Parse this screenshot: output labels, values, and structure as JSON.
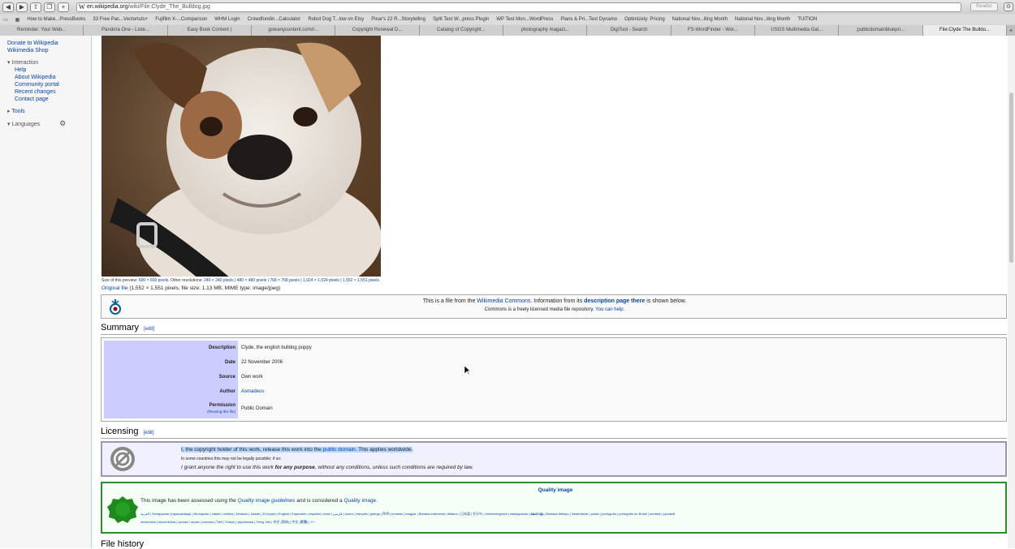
{
  "browser": {
    "url_host": "en.wikipedia.org",
    "url_path": "/wiki/File:Clyde_The_Bulldog.jpg",
    "reader_label": "Reader",
    "bookmarks": [
      "How to Make...PressBooks",
      "33 Free Pac...Vectortuts+",
      "Fujifilm X-...Comparison",
      "WHM Login",
      "Crowdfundin...Calculator",
      "Robot Dog T...low on Etsy",
      "Pixar's 22 R...Storytelling",
      "Split Test W...press Plugin",
      "WP Test Mon...WordPress",
      "Plans & Pri...Test Dynamo",
      "Optimizely: Pricing",
      "National Nov...iting Month",
      "National Nov...iting Month",
      "TUITION"
    ],
    "tabs": [
      "Reminder: Your Web...",
      "Pandora One - Liste...",
      "Easy Book Content |",
      "gowanycontent.com/r...",
      "Copyright Renewal D...",
      "Catalog of Copyright...",
      "photography magazi...",
      "DigiTool - Search",
      "FS-WordFinder - Wor...",
      "USGS Multimedia Gal...",
      "publicdomainbluepri...",
      "File:Clyde The Bulldo..."
    ]
  },
  "sidebar": {
    "top_links": [
      "Donate to Wikipedia",
      "Wikimedia Shop"
    ],
    "interaction_title": "Interaction",
    "interaction_links": [
      "Help",
      "About Wikipedia",
      "Community portal",
      "Recent changes",
      "Contact page"
    ],
    "tools_title": "Tools",
    "languages_title": "Languages"
  },
  "file": {
    "preview_prefix": "Size of this preview:",
    "preview_size": "600 × 600 pixels",
    "other_res_label": ". Other resolutions:",
    "other_res": "240 × 240 pixels | 480 × 480 pixels | 768 × 768 pixels | 1,024 × 1,024 pixels | 1,552 × 1,551 pixels.",
    "original_link": "Original file",
    "original_info": "(1,552 × 1,551 pixels, file size: 1.13 MB, MIME type: image/jpeg)"
  },
  "commons": {
    "line1_a": "This is a file from the",
    "line1_link": "Wikimedia Commons",
    "line1_b": ". Information from its",
    "line1_link2": "description page there",
    "line1_c": "is shown below.",
    "line2_a": "Commons is a freely licensed media file repository.",
    "line2_link": "You can help."
  },
  "summary": {
    "heading": "Summary",
    "edit": "[edit]",
    "rows": [
      {
        "label": "Description",
        "value": "Clyde, the english bulldog puppy"
      },
      {
        "label": "Date",
        "value": "22 November 2006"
      },
      {
        "label": "Source",
        "value": "Own work"
      },
      {
        "label": "Author",
        "value": "Asmadeus"
      },
      {
        "label": "Permission",
        "sub": "(Reusing this file)",
        "value": "Public Domain"
      }
    ]
  },
  "licensing": {
    "heading": "Licensing",
    "edit": "[edit]",
    "line1_a": "I, the copyright holder of this work, release this work into the",
    "line1_link": "public domain",
    "line1_b": ". This applies worldwide.",
    "line2": "In some countries this may not be legally possible; if so:",
    "line3_a": "I grant anyone the right to use this work",
    "line3_bold": "for any purpose",
    "line3_b": ", without any conditions, unless such conditions are required by law."
  },
  "quality": {
    "title": "Quality image",
    "text_a": "This image has been assessed using the",
    "text_link": "Quality image guidelines",
    "text_b": "and is considered a",
    "text_link2": "Quality image",
    "text_c": ".",
    "lang_line1": "العربية | беларуская (тарашкевіца) | български | català | čeština | Deutsch | Zazaki | Ελληνικά | English | Esperanto | español | eesti | فارسی | suomi | français | galego | हिन्दी | hrvatski | magyar | Bahasa Indonesia | italiano | 日本語 | 한국어 | Lëtzebuergesch | македонски | മലയാളം | Bahasa Melayu | Nederlands | polski | português | português do Brasil | română | русский",
    "lang_line2": "slovenčina | slovenščina | српски / srpski | svenska | ไทย | Türkçe | українська | Tiếng Việt | 中文 (简体) | 中文 (繁體) | +/−"
  },
  "file_history": {
    "heading": "File history"
  }
}
